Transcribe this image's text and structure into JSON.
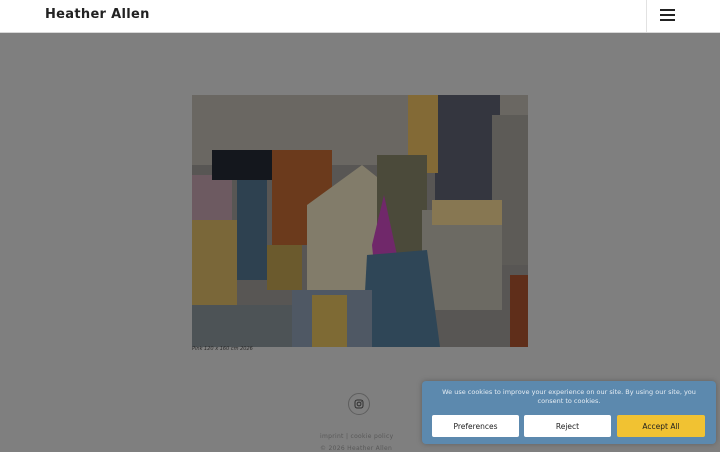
{
  "header": {
    "site_title": "Heather Allen",
    "menu_icon": "hamburger-menu-icon"
  },
  "artwork": {
    "caption": "Pink 120 x 160 cm  2026"
  },
  "footer": {
    "social_icon": "instagram-icon",
    "imprint_label": "imprint",
    "separator": "|",
    "cookie_policy_label": "cookie policy",
    "copyright": "© 2026 Heather Allen"
  },
  "cookie_banner": {
    "message": "We use cookies to improve your experience on our site. By using our site, you consent to cookies.",
    "preferences_label": "Preferences",
    "reject_label": "Reject",
    "accept_label": "Accept All",
    "background_color": "#5c89ae",
    "accept_color": "#f1c232"
  }
}
